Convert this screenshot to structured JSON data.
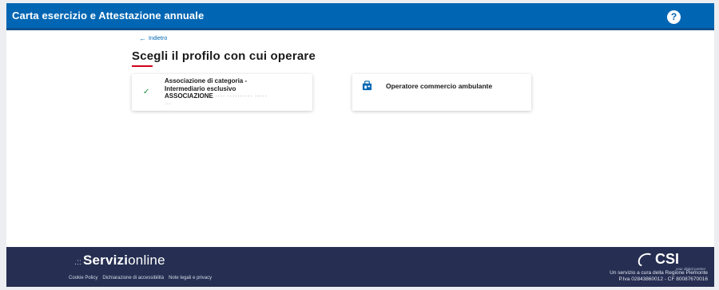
{
  "header": {
    "title": "Carta esercizio e Attestazione annuale",
    "help_icon": "help-icon"
  },
  "main": {
    "back_label": "Indietro",
    "page_title": "Scegli il profilo con cui operare",
    "accent_color": "#d0021b",
    "cards": [
      {
        "selected": true,
        "icon": "check-icon",
        "line1": "Associazione di categoria -",
        "line2": "Intermediario esclusivo",
        "org_prefix": "ASSOCIAZIONE",
        "org_redacted": "···· ·········· ·····",
        "line4_redacted": "···"
      },
      {
        "selected": false,
        "icon": "shop-icon",
        "label": "Operatore commercio ambulante"
      }
    ]
  },
  "footer": {
    "logo_dots": ".::",
    "logo_strong": "Servizi",
    "logo_light": "online",
    "links": [
      "Cookie Policy",
      "Dichiarazione di accessibilità",
      "Note legali e privacy"
    ],
    "csi_logo_text": "CSI",
    "csi_tagline": "your digital partner",
    "info_line1": "Un servizio a cura della Regione Piemonte",
    "info_line2": "P.Iva 02843860012 - CF 80087670016"
  },
  "colors": {
    "header_bg": "#0066b3",
    "footer_bg": "#262e52",
    "check": "#1a8a3c"
  }
}
